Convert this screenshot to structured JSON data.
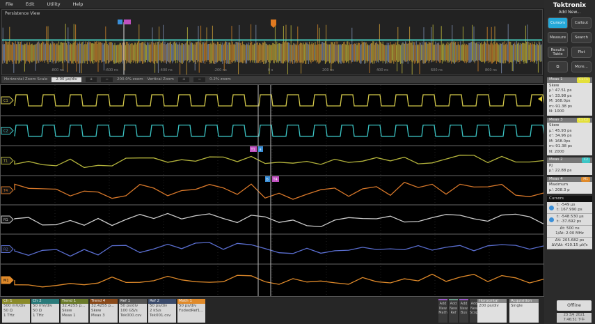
{
  "menu": [
    "File",
    "Edit",
    "Utility",
    "Help"
  ],
  "overview": {
    "title": "Persistence View",
    "time_labels": [
      "-800 ns",
      "-600 ns",
      "-400 ns",
      "-200 ns",
      "0 s",
      "200 ns",
      "400 ns",
      "600 ns",
      "800 ns"
    ]
  },
  "zoombar": {
    "h_label": "Horizontal Zoom Scale",
    "h_value": "2.00 μs/div",
    "plus": "+",
    "minus": "−",
    "h_zoom": "200.0% zoom",
    "v_label": "Vertical Zoom",
    "v_zoom": "0.2% zoom"
  },
  "lanes": [
    {
      "label": "C1",
      "color": "#d4c94a"
    },
    {
      "label": "C2",
      "color": "#3cc6c6"
    },
    {
      "label": "T1",
      "color": "#b4b43c"
    },
    {
      "label": "T4",
      "color": "#d8782a"
    },
    {
      "label": "R1",
      "color": "#cccccc"
    },
    {
      "label": "R2",
      "color": "#5a6ed0"
    },
    {
      "label": "M1",
      "color": "#e08a2a"
    }
  ],
  "cursor_labels": {
    "a": "a",
    "b": "b",
    "t1": "T1",
    "t4": "T4"
  },
  "brand": "Tektronix",
  "add_new": "Add New...",
  "buttons": [
    "Cursors",
    "Callout",
    "Measure",
    "Search",
    "Results Table",
    "Plot",
    "⧉",
    "More..."
  ],
  "meas": [
    {
      "title": "Meas 1",
      "tag": "C1 T1",
      "lines": [
        "Skew",
        "μ': 47.51 ps",
        "σ': 33.98 ps",
        "M: 168.0ps",
        "m:-91.38 ps",
        "N: 1000"
      ],
      "tagcolor": "#e4e03a"
    },
    {
      "title": "Meas 3",
      "tag": "C1 C2",
      "lines": [
        "Skew",
        "μ': 45.93 ps",
        "σ': 34.96 ps",
        "M: 168.0ps",
        "m:-91.38 ps",
        "N: 2000"
      ],
      "tagcolor": "#e4e03a"
    },
    {
      "title": "Meas 2",
      "tag": "C2",
      "lines": [
        "PJ",
        "μ': 22.88 ps"
      ],
      "tagcolor": "#3cc6c6"
    },
    {
      "title": "Meas 4",
      "tag": "M1",
      "lines": [
        "Maximum",
        "μ': 208.3 p"
      ],
      "tagcolor": "#e08a2a"
    }
  ],
  "cursors": {
    "title": "Cursors",
    "a": [
      "t: -549 μs",
      "t: 167.990 ps"
    ],
    "b": [
      "t: -548.530 μs",
      "t: -37.692 ps"
    ],
    "d1": [
      "Δt: 500 ns",
      "1/Δt: 2.00 MHz"
    ],
    "d2": [
      "ΔV: 205.682 ps",
      "ΔV/Δt: 410.15 μV/s"
    ]
  },
  "channels": [
    {
      "title": "Ch 1",
      "lines": [
        "500 mV/div",
        "50 Ω",
        "1 THz"
      ],
      "color": "#8a8a2a"
    },
    {
      "title": "Ch 2",
      "lines": [
        "50 mV/div",
        "50 Ω",
        "1 THz"
      ],
      "color": "#2a7a7a"
    },
    {
      "title": "Trend 1",
      "lines": [
        "32.4255 p...",
        "Skew",
        "Meas 1"
      ],
      "color": "#6a7a2a"
    },
    {
      "title": "Trend 4",
      "lines": [
        "32.4255 p...",
        "Skew",
        "Meas 3"
      ],
      "color": "#8a4a1a"
    },
    {
      "title": "Ref 1",
      "lines": [
        "50 ps/div",
        "100 GS/s",
        "Tek000.csv"
      ],
      "color": "#555"
    },
    {
      "title": "Ref 2",
      "lines": [
        "50 ps/div",
        "2 kS/s",
        "Tek001.csv"
      ],
      "color": "#3a4a6a"
    },
    {
      "title": "Math 1",
      "lines": [
        "50 ps/div",
        "FxdwdRef1..."
      ],
      "color": "#e08a2a"
    }
  ],
  "add_buttons": [
    {
      "label": "Add New Math",
      "color": "#9a5ac8"
    },
    {
      "label": "Add New Ref",
      "color": "#6a9a8a"
    },
    {
      "label": "Add New Bus",
      "color": "#9a5ac8"
    },
    {
      "label": "Add New Scope",
      "color": "#444"
    }
  ],
  "horizontal": {
    "title": "Horizontal",
    "value": "200 ps/div"
  },
  "acquisition": {
    "title": "Acquisition",
    "value": "Single"
  },
  "offline": "Offline",
  "date": [
    "23 3月 2021",
    "7:46:51 下午"
  ]
}
